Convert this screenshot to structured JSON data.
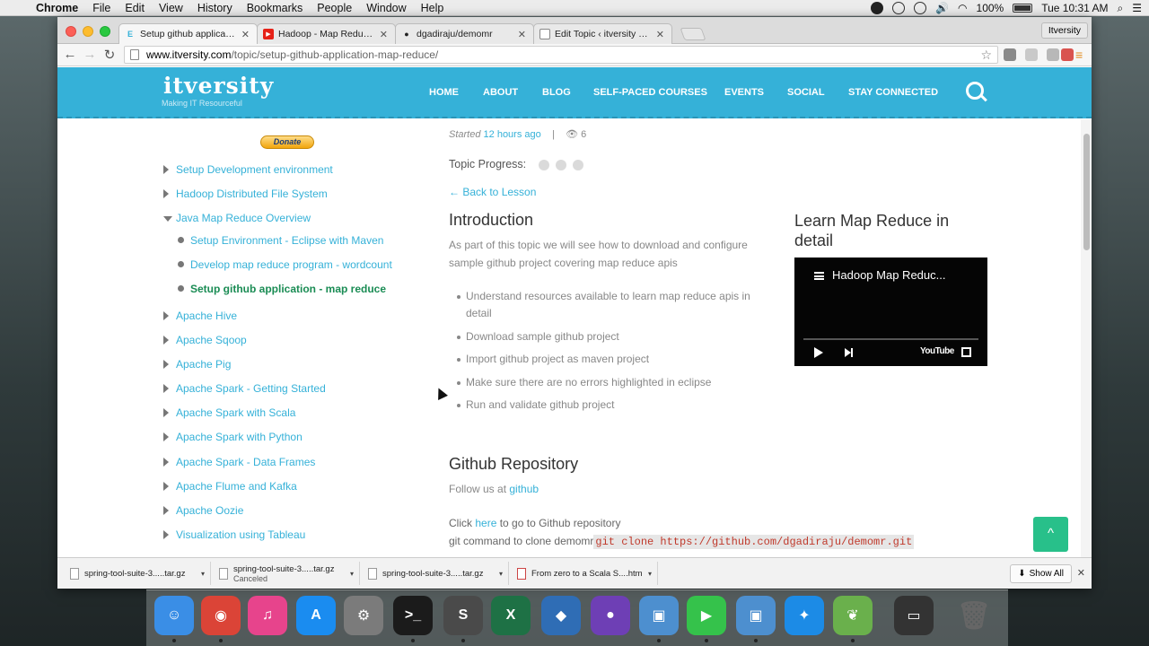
{
  "menubar": {
    "app": "Chrome",
    "menus": [
      "File",
      "Edit",
      "View",
      "History",
      "Bookmarks",
      "People",
      "Window",
      "Help"
    ],
    "battery": "100%",
    "clock": "Tue 10:31 AM"
  },
  "browser": {
    "tabs": [
      {
        "title": "Setup github application - ",
        "favicon": "E",
        "favicon_color": "#35b1d8"
      },
      {
        "title": "Hadoop - Map Reduce appl",
        "favicon": "▶",
        "favicon_color": "#e62117"
      },
      {
        "title": "dgadiraju/demomr",
        "favicon": "●",
        "favicon_color": "#222222"
      },
      {
        "title": "Edit Topic ‹ itversity — Wo",
        "favicon": "",
        "favicon_color": "#ffffff"
      }
    ],
    "profile": "Itversity",
    "url_domain": "www.itversity.com",
    "url_path": "/topic/setup-github-application-map-reduce/"
  },
  "site": {
    "logo": "itversity",
    "tagline": "Making IT Resourceful",
    "nav": [
      "HOME",
      "ABOUT",
      "BLOG",
      "SELF-PACED COURSES",
      "EVENTS",
      "SOCIAL",
      "STAY CONNECTED"
    ],
    "brand_color": "#35b1d8"
  },
  "sidebar": {
    "donate": "Donate",
    "items": [
      "Setup Development environment",
      "Hadoop Distributed File System",
      "Java Map Reduce Overview",
      "Apache Hive",
      "Apache Sqoop",
      "Apache Pig",
      "Apache Spark - Getting Started",
      "Apache Spark with Scala",
      "Apache Spark with Python",
      "Apache Spark - Data Frames",
      "Apache Flume and Kafka",
      "Apache Oozie",
      "Visualization using Tableau"
    ],
    "subitems": [
      "Setup Environment - Eclipse with Maven",
      "Develop map reduce program - wordcount",
      "Setup github application - map reduce"
    ]
  },
  "topic": {
    "started_label": "Started",
    "started_ago": "12 hours ago",
    "separator": "|",
    "views": "6",
    "progress_label": "Topic Progress:",
    "back": "← Back to Lesson",
    "intro_heading": "Introduction",
    "intro_text": "As part of this topic we will see how to download and configure sample github project covering map reduce apis",
    "bullets": [
      "Understand resources available to learn map reduce apis in detail",
      "Download sample github project",
      "Import github project as maven project",
      "Make sure there are no errors highlighted in eclipse",
      "Run and validate github project"
    ],
    "repo_heading": "Github Repository",
    "follow_text": "Follow us at",
    "follow_link": "github",
    "click_text": "Click",
    "click_link": "here",
    "click_rest": "to go to Github repository",
    "git_text": "git command to clone demomr",
    "git_cmd": "git clone https://github.com/dgadiraju/demomr.git"
  },
  "video_panel": {
    "heading": "Learn Map Reduce in detail",
    "title": "Hadoop Map Reduc...",
    "brand": "YouTube"
  },
  "scroll_top": "^",
  "downloads": {
    "items": [
      {
        "name": "spring-tool-suite-3.....tar.gz",
        "status": ""
      },
      {
        "name": "spring-tool-suite-3.....tar.gz",
        "status": "Canceled"
      },
      {
        "name": "spring-tool-suite-3.....tar.gz",
        "status": ""
      },
      {
        "name": "From zero to a Scala S....htm",
        "status": ""
      }
    ],
    "show_all": "Show All",
    "close": "✕"
  },
  "dock": {
    "apps": [
      {
        "name": "finder-icon",
        "color": "#3a8ee6",
        "glyph": "☺"
      },
      {
        "name": "chrome-icon",
        "color": "#db4437",
        "glyph": "◉"
      },
      {
        "name": "itunes-icon",
        "color": "#e7448c",
        "glyph": "♫"
      },
      {
        "name": "app-store-icon",
        "color": "#1a8cf0",
        "glyph": "A"
      },
      {
        "name": "system-preferences-icon",
        "color": "#7b7b7b",
        "glyph": "⚙"
      },
      {
        "name": "terminal-icon",
        "color": "#1b1b1b",
        "glyph": ">_"
      },
      {
        "name": "sublime-text-icon",
        "color": "#4a4a4a",
        "glyph": "S"
      },
      {
        "name": "excel-icon",
        "color": "#1e7145",
        "glyph": "X"
      },
      {
        "name": "virtualbox-icon",
        "color": "#2f6db5",
        "glyph": "◆"
      },
      {
        "name": "github-desktop-icon",
        "color": "#6e3fb5",
        "glyph": "●"
      },
      {
        "name": "preview-icon",
        "color": "#4d8fcf",
        "glyph": "▣"
      },
      {
        "name": "facetime-icon",
        "color": "#35c24b",
        "glyph": "▶"
      },
      {
        "name": "photo-icon",
        "color": "#4d8fcf",
        "glyph": "▣"
      },
      {
        "name": "safari-icon",
        "color": "#1c8be6",
        "glyph": "✦"
      },
      {
        "name": "spring-tool-suite-icon",
        "color": "#6ab04c",
        "glyph": "❦"
      },
      {
        "name": "minimized-window-icon",
        "color": "#333333",
        "glyph": "▭"
      },
      {
        "name": "trash-icon",
        "color": "#cfd3d6",
        "glyph": "🗑"
      }
    ]
  }
}
